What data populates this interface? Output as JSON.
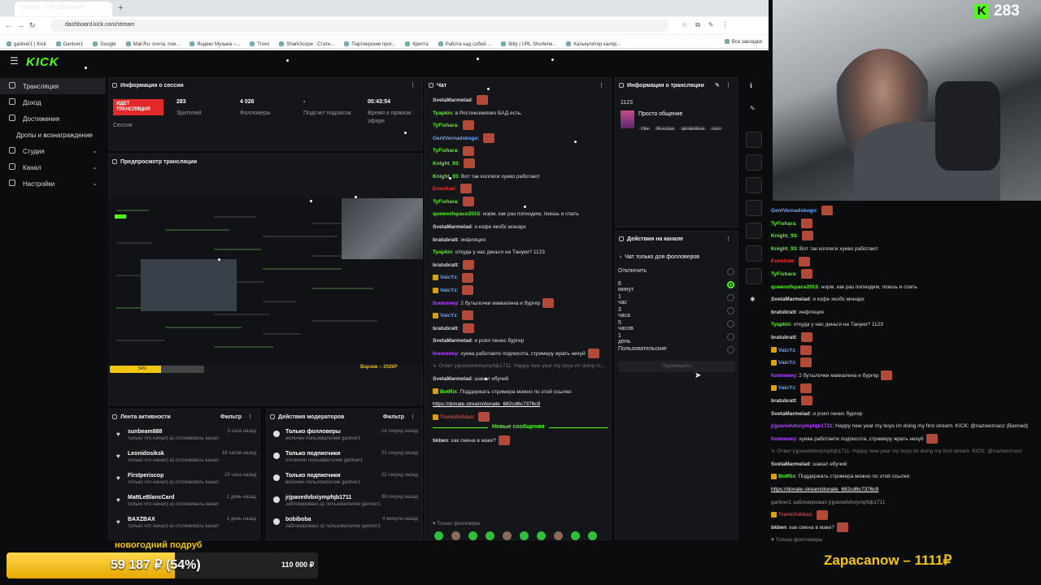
{
  "browser": {
    "tab_title": "Stream – Kick Dashboard",
    "url": "dashboard.kick.com/stream",
    "bookmarks": [
      "gantver1 | Kick",
      "Gantver1",
      "Google",
      "Mail.Ru: почта, пои...",
      "Яндекс Музыка –...",
      "Trovo",
      "SharkScope : Стати...",
      "Партнерские прог...",
      "Крипта",
      "Работа над собой ...",
      "Bitly | URL Shortene...",
      "Калькулятор калор..."
    ],
    "all_bookmarks": "Все закладки"
  },
  "dashboard": {
    "logo": "KICK",
    "nav": [
      {
        "label": "Трансляция",
        "active": true
      },
      {
        "label": "Доход"
      },
      {
        "label": "Достижения"
      },
      {
        "label": "Дропы и вознаграждение"
      },
      {
        "label": "Студия",
        "chevron": "⌄"
      },
      {
        "label": "Канал",
        "chevron": "⌄"
      },
      {
        "label": "Настройки",
        "chevron": "⌄"
      }
    ],
    "session": {
      "title": "Информация о сессии",
      "live_badge": "ИДЕТ ТРАНСЛЯЦИЯ",
      "session_label": "Сессия",
      "viewers": "283",
      "viewers_label": "Зрителей",
      "followers": "4 026",
      "followers_label": "Фолловеры",
      "subs": "-",
      "subs_label": "Подсчет подписок",
      "uptime": "00:43:54",
      "uptime_label": "Время в прямом эфире"
    },
    "preview": {
      "title": "Предпросмотр трансляции",
      "caption": "Варзив – 2026Р",
      "bar_text": "54%"
    },
    "activity": {
      "title": "Лента активности",
      "filter": "Фильтр",
      "items": [
        {
          "name": "sunbeam888",
          "desc": "только что начал(-а) отслеживать канал",
          "time": "3 часа назад"
        },
        {
          "name": "Leonidosiksk",
          "desc": "только что начал(-а) отслеживать канал",
          "time": "18 часов назад"
        },
        {
          "name": "Firstperiscop",
          "desc": "только что начал(-а) отслеживать канал",
          "time": "23 часа назад"
        },
        {
          "name": "MattLeBlancCard",
          "desc": "только что начал(-а) отслеживать канал",
          "time": "1 день назад"
        },
        {
          "name": "BAXZBAX",
          "desc": "только что начал(-а) отслеживать канал",
          "time": "1 день назад"
        }
      ]
    },
    "modactions": {
      "title": "Действия модераторов",
      "filter": "Фильтр",
      "items": [
        {
          "name": "Только фолловеры",
          "desc": "включен пользователем gantver1",
          "time": "14 секунд назад"
        },
        {
          "name": "Только подписчики",
          "desc": "отключен пользователем gantver1",
          "time": "22 секунд назад"
        },
        {
          "name": "Только подписчики",
          "desc": "включен пользователем gantver1",
          "time": "22 секунд назад"
        },
        {
          "name": "jrjpavedvbxiympfqb1711",
          "desc": "заблокирован(-а) пользователем gantver1",
          "time": "39 секунд назад"
        },
        {
          "name": "bobiboba",
          "desc": "заблокирован(-а) пользователем gantver1",
          "time": "4 минуты назад"
        }
      ]
    },
    "chat": {
      "title": "Чат",
      "messages": [
        {
          "user": "SvetaMarmelad",
          "color": "#ddd",
          "text": "",
          "emote": true
        },
        {
          "user": "Tyapkin",
          "color": "#53fc18",
          "text": "в Ростиксемпяко БАД есть."
        },
        {
          "user": "TyFishara",
          "color": "#53fc18",
          "text": "",
          "emote": true
        },
        {
          "user": "GentVernadskogo",
          "color": "#6aa7ff",
          "text": "",
          "emote": true
        },
        {
          "user": "TyFishara",
          "color": "#53fc18",
          "text": "",
          "emote": true
        },
        {
          "user": "Knight_93",
          "color": "#53fc18",
          "text": "",
          "emote": true
        },
        {
          "user": "Knight_93",
          "color": "#53fc18",
          "text": "Вот так коллеги хуево работают"
        },
        {
          "user": "EvenXan",
          "color": "#e33",
          "text": "",
          "emote": true
        },
        {
          "user": "TyFishara",
          "color": "#53fc18",
          "text": "",
          "emote": true
        },
        {
          "user": "queenofspace2015",
          "color": "#53fc18",
          "text": "норм, как раз попиздим, поешь и спать"
        },
        {
          "user": "SvetaMarmelad",
          "color": "#ddd",
          "text": "и кофе якобс монарх"
        },
        {
          "user": "bratubratt",
          "color": "#ddd",
          "text": "инфляция"
        },
        {
          "user": "Tyapkin",
          "color": "#53fc18",
          "text": "откуда у нас деньги на Тануки? 1123"
        },
        {
          "user": "bratubratt",
          "color": "#ddd",
          "text": "",
          "emote": true
        },
        {
          "user": "VaicYz",
          "color": "#6aa7ff",
          "text": "",
          "emote": true,
          "badge": true
        },
        {
          "user": "VaicYz",
          "color": "#6aa7ff",
          "text": "",
          "emote": true,
          "badge": true
        },
        {
          "user": "foxmoney",
          "color": "#b44cff",
          "text": "2 бутылочки маккалена и бургер",
          "emote": true
        },
        {
          "user": "VaicYz",
          "color": "#6aa7ff",
          "text": "",
          "emote": true,
          "badge": true
        },
        {
          "user": "bratubratt",
          "color": "#ddd",
          "text": "",
          "emote": true
        },
        {
          "user": "SvetaMarmelad",
          "color": "#ddd",
          "text": "и роял пенис бургер"
        },
        {
          "user": "foxmoney",
          "color": "#b44cff",
          "text": "хуева работаете подписота, стримеру жрать нехуй",
          "emote": true
        },
        {
          "user": "",
          "color": "#777",
          "text": "↳ Ответ jrjpavedvbxiympfqb1711: Happy new year my boys im doing m..."
        },
        {
          "user": "SvetaMarmelad",
          "color": "#ddd",
          "text": "шакал ебучий"
        },
        {
          "user": "BotRix",
          "color": "#53fc18",
          "text": "Поддержать стримера можно по этой ссылке:",
          "badge": true
        },
        {
          "user": "",
          "color": "#fff",
          "text": "https://donate.stream/donate_682cd6c7376c9"
        },
        {
          "user": "TranklAdidas",
          "color": "#e33",
          "text": "",
          "emote": true,
          "badge": true
        }
      ],
      "new_messages": "Новые сообщения",
      "after": [
        {
          "user": "bkben",
          "color": "#ddd",
          "text": "как смена в маке?",
          "emote": true
        }
      ],
      "followers_only": "Только фолловеры"
    },
    "stream_info": {
      "title": "Информация о трансляции",
      "number": "1123",
      "stream_title": "Просто общение",
      "tags": [
        "18+",
        "Russian",
        "alcoholism",
        "casi"
      ]
    },
    "channel_actions": {
      "title": "Действия на канале",
      "sub_title": "Чат только для фолловеров",
      "options": [
        "Отключить",
        "6 минут",
        "1 час",
        "3 часа",
        "5 часов",
        "1 день",
        "Пользовательские"
      ],
      "selected": "6 минут",
      "confirm": "Подтвердить"
    }
  },
  "overlay": {
    "viewers": "283",
    "chat": [
      {
        "user": "GentVernadskogo",
        "color": "#6aa7ff",
        "text": "",
        "emote": true
      },
      {
        "user": "TyFishara",
        "color": "#53fc18",
        "text": "",
        "emote": true
      },
      {
        "user": "Knight_93",
        "color": "#53fc18",
        "text": "",
        "emote": true
      },
      {
        "user": "Knight_93",
        "color": "#53fc18",
        "text": "Вот так коллеги хуево работают"
      },
      {
        "user": "EvenXan",
        "color": "#e33",
        "text": "",
        "emote": true
      },
      {
        "user": "TyFishara",
        "color": "#53fc18",
        "text": "",
        "emote": true
      },
      {
        "user": "queenofspace2015",
        "color": "#53fc18",
        "text": "норм, как раз попиздим, поешь и спать"
      },
      {
        "user": "SvetaMarmelad",
        "color": "#ddd",
        "text": "и кофе якобс монарх"
      },
      {
        "user": "bratubratt",
        "color": "#ddd",
        "text": "инфляция"
      },
      {
        "user": "Tyapkin",
        "color": "#53fc18",
        "text": "откуда у нас деньги на Тануки? 1123"
      },
      {
        "user": "bratubratt",
        "color": "#ddd",
        "text": "",
        "emote": true
      },
      {
        "user": "VaicYz",
        "color": "#6aa7ff",
        "text": "",
        "emote": true,
        "badge": true
      },
      {
        "user": "VaicYz",
        "color": "#6aa7ff",
        "text": "",
        "emote": true,
        "badge": true
      },
      {
        "user": "foxmoney",
        "color": "#b44cff",
        "text": "2 бутылочки маккалена и бургер",
        "emote": true
      },
      {
        "user": "VaicYz",
        "color": "#6aa7ff",
        "text": "",
        "emote": true,
        "badge": true
      },
      {
        "user": "bratubratt",
        "color": "#ddd",
        "text": "",
        "emote": true
      },
      {
        "user": "SvetaMarmelad",
        "color": "#ddd",
        "text": "и роял пенис бургер"
      },
      {
        "user": "jrjpavedvbxiympfqb1711",
        "color": "#b44cff",
        "text": "Happy new year my boys im doing my first stream. KICK: @nazweznasz (Banned)"
      },
      {
        "user": "foxmoney",
        "color": "#b44cff",
        "text": "хуева работаете подписота, стримеру жрать нехуй",
        "emote": true
      },
      {
        "user": "",
        "color": "#777",
        "text": "↳ Ответ jrjpavedvbxiympfqb1711: Happy new year my boys im doing my first stream. KICK: @nazweznasz"
      },
      {
        "user": "SvetaMarmelad",
        "color": "#ddd",
        "text": "шакал ебучий"
      },
      {
        "user": "BotRix",
        "color": "#53fc18",
        "text": "Поддержать стримера можно по этой ссылке:",
        "badge": true
      },
      {
        "user": "",
        "color": "#fff",
        "text": "https://donate.stream/donate_682cd6c7376c9"
      },
      {
        "user": "",
        "color": "#999",
        "text": "gantver1 заблокировал jrjpavedvbxiympfqb1711"
      },
      {
        "user": "TranklAdidas",
        "color": "#e33",
        "text": "",
        "emote": true,
        "badge": true
      },
      {
        "user": "bkben",
        "color": "#ddd",
        "text": "как смена в маке?",
        "emote": true
      },
      {
        "user": "",
        "color": "#888",
        "text": "♥ Только фолловеры"
      }
    ],
    "goal": {
      "title": "новогодний подруб",
      "current": "59 187 ₽ (54%)",
      "target": "110 000 ₽",
      "percent": 54
    },
    "donation": "Zapacanow – 1111₽"
  }
}
